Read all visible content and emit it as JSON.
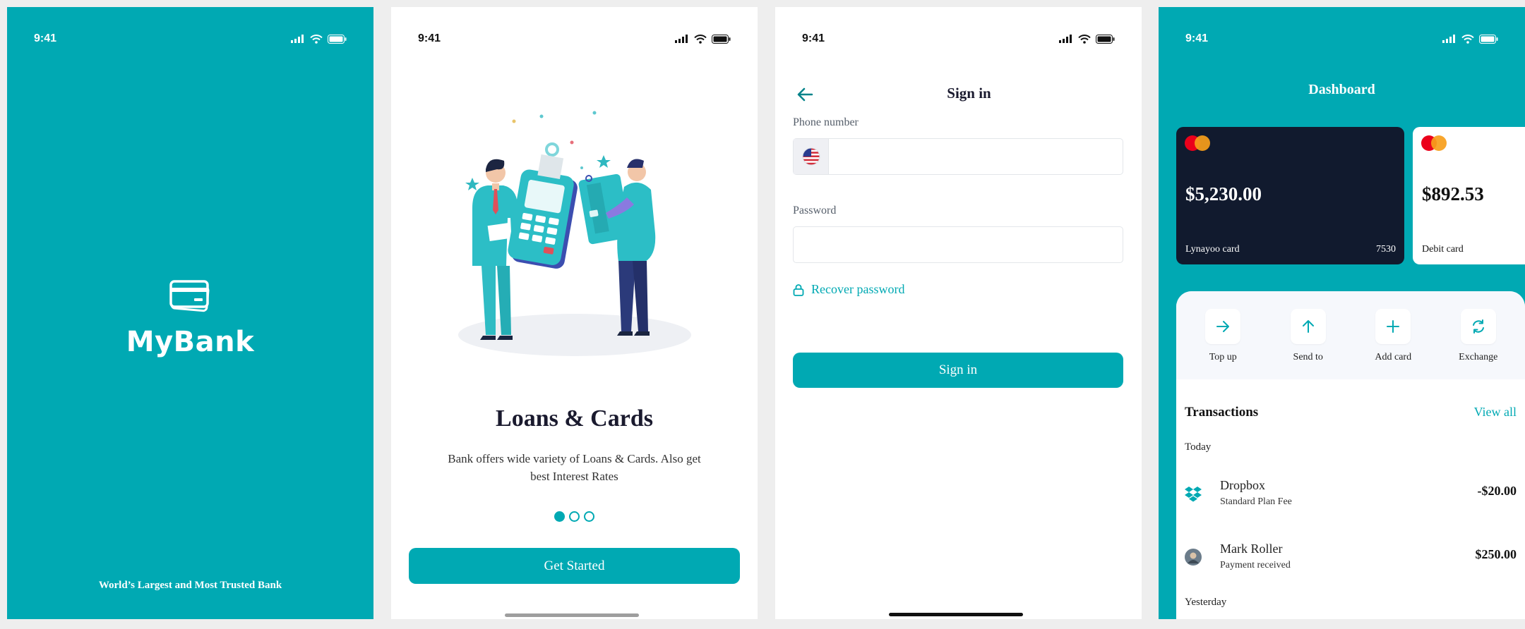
{
  "status": {
    "time": "9:41"
  },
  "splash": {
    "brand": "MyBank",
    "tagline": "World’s Largest and Most Trusted Bank"
  },
  "onboarding": {
    "title": "Loans & Cards",
    "description": "Bank offers wide variety of Loans & Cards. Also get best Interest Rates",
    "page_index": 0,
    "page_count": 3,
    "cta_label": "Get Started"
  },
  "signin": {
    "title": "Sign in",
    "phone_label": "Phone number",
    "phone_value": "",
    "password_label": "Password",
    "password_value": "",
    "recover_label": "Recover password",
    "submit_label": "Sign in"
  },
  "dashboard": {
    "title": "Dashboard",
    "cards": [
      {
        "amount": "$5,230.00",
        "name": "Lynayoo card",
        "number": "7530"
      },
      {
        "amount": "$892.53",
        "name": "Debit card",
        "number": ""
      }
    ],
    "actions": [
      {
        "label": "Top up",
        "icon": "arrow-right-icon"
      },
      {
        "label": "Send to",
        "icon": "arrow-up-icon"
      },
      {
        "label": "Add card",
        "icon": "plus-icon"
      },
      {
        "label": "Exchange",
        "icon": "refresh-icon"
      }
    ],
    "transactions_title": "Transactions",
    "view_all_label": "View all",
    "groups": [
      {
        "label": "Today",
        "items": [
          {
            "name": "Dropbox",
            "subtitle": "Standard Plan Fee",
            "amount": "-$20.00",
            "icon": "dropbox-icon"
          },
          {
            "name": "Mark Roller",
            "subtitle": "Payment received",
            "amount": "$250.00",
            "icon": "avatar"
          }
        ]
      },
      {
        "label": "Yesterday",
        "items": []
      }
    ]
  },
  "colors": {
    "accent": "#00a9b3",
    "card_dark": "#111a2e",
    "panel_bg": "#f6f8fc"
  }
}
